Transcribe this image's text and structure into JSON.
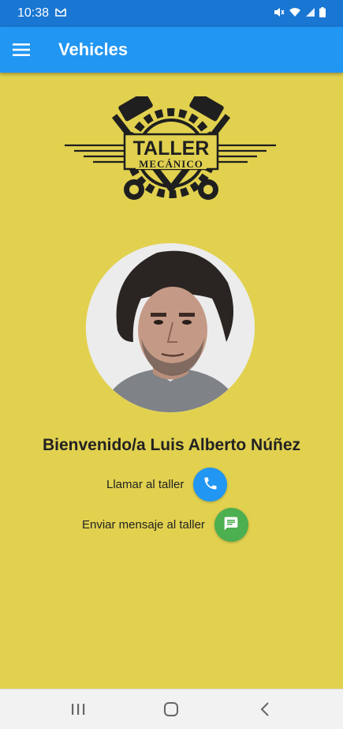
{
  "status_bar": {
    "time": "10:38",
    "icons": [
      "gmail-icon",
      "mute-icon",
      "wifi-icon",
      "signal-icon",
      "battery-icon"
    ]
  },
  "app_bar": {
    "title": "Vehicles",
    "menu_icon": "hamburger-menu-icon",
    "color": "#2196f3"
  },
  "logo": {
    "line1": "TALLER",
    "line2": "MECÁNICO"
  },
  "profile": {
    "welcome": "Bienvenido/a Luis Alberto  Núñez"
  },
  "actions": {
    "call_label": "Llamar al taller",
    "call_color": "#2196f3",
    "message_label": "Enviar mensaje al taller",
    "message_color": "#4caf50"
  },
  "nav": {
    "icons": [
      "recents-icon",
      "home-icon",
      "back-icon"
    ]
  },
  "colors": {
    "background": "#e1d14f"
  }
}
